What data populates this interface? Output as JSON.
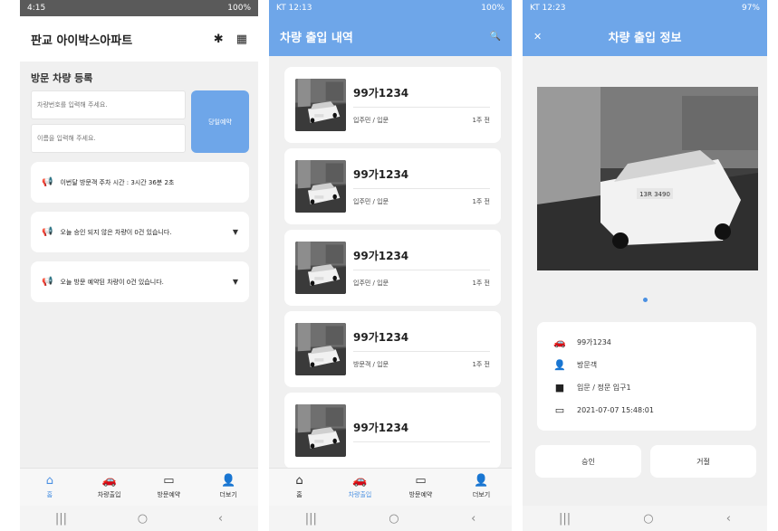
{
  "screen1": {
    "status": {
      "time": "4:15",
      "icons": "▲",
      "battery": "100%"
    },
    "title": "판교 아이박스아파트",
    "section_title": "방문 차량 등록",
    "plate_placeholder": "차량번호를 입력해 주세요.",
    "name_placeholder": "이름을 입력해 주세요.",
    "register_button": "당일예약",
    "notices": [
      {
        "text": "이번달 방문객 주차 시간 : 3시간 36분 2초"
      },
      {
        "text": "오늘 승인 되지 않은 차량이 0건 있습니다."
      },
      {
        "text": "오늘 방문 예약된 차량이 0건 있습니다."
      }
    ]
  },
  "screen2": {
    "status": {
      "carrier": "KT 12:13",
      "battery": "100%"
    },
    "title": "차량 출입 내역",
    "records": [
      {
        "plate": "99가1234",
        "type": "입주민 / 입문",
        "time": "1주 전"
      },
      {
        "plate": "99가1234",
        "type": "입주민 / 입문",
        "time": "1주 전"
      },
      {
        "plate": "99가1234",
        "type": "입주민 / 입문",
        "time": "1주 전"
      },
      {
        "plate": "99가1234",
        "type": "방문객 / 입문",
        "time": "1주 전"
      },
      {
        "plate": "99가1234",
        "type": "",
        "time": ""
      }
    ]
  },
  "screen3": {
    "status": {
      "carrier": "KT 12:23",
      "battery": "97%"
    },
    "title": "차량 출입 정보",
    "photo_plate": "13R 3490",
    "info": {
      "plate": "99가1234",
      "visitor_type": "방문객",
      "gate": "입문 / 정문 입구1",
      "datetime": "2021-07-07 15:48:01"
    },
    "approve_button": "승인",
    "reject_button": "거절"
  },
  "tabs": [
    {
      "label": "홈"
    },
    {
      "label": "차량출입"
    },
    {
      "label": "방문예약"
    },
    {
      "label": "더보기"
    }
  ],
  "colors": {
    "accent": "#6ea6e9",
    "active_tab": "#4a90e2"
  }
}
